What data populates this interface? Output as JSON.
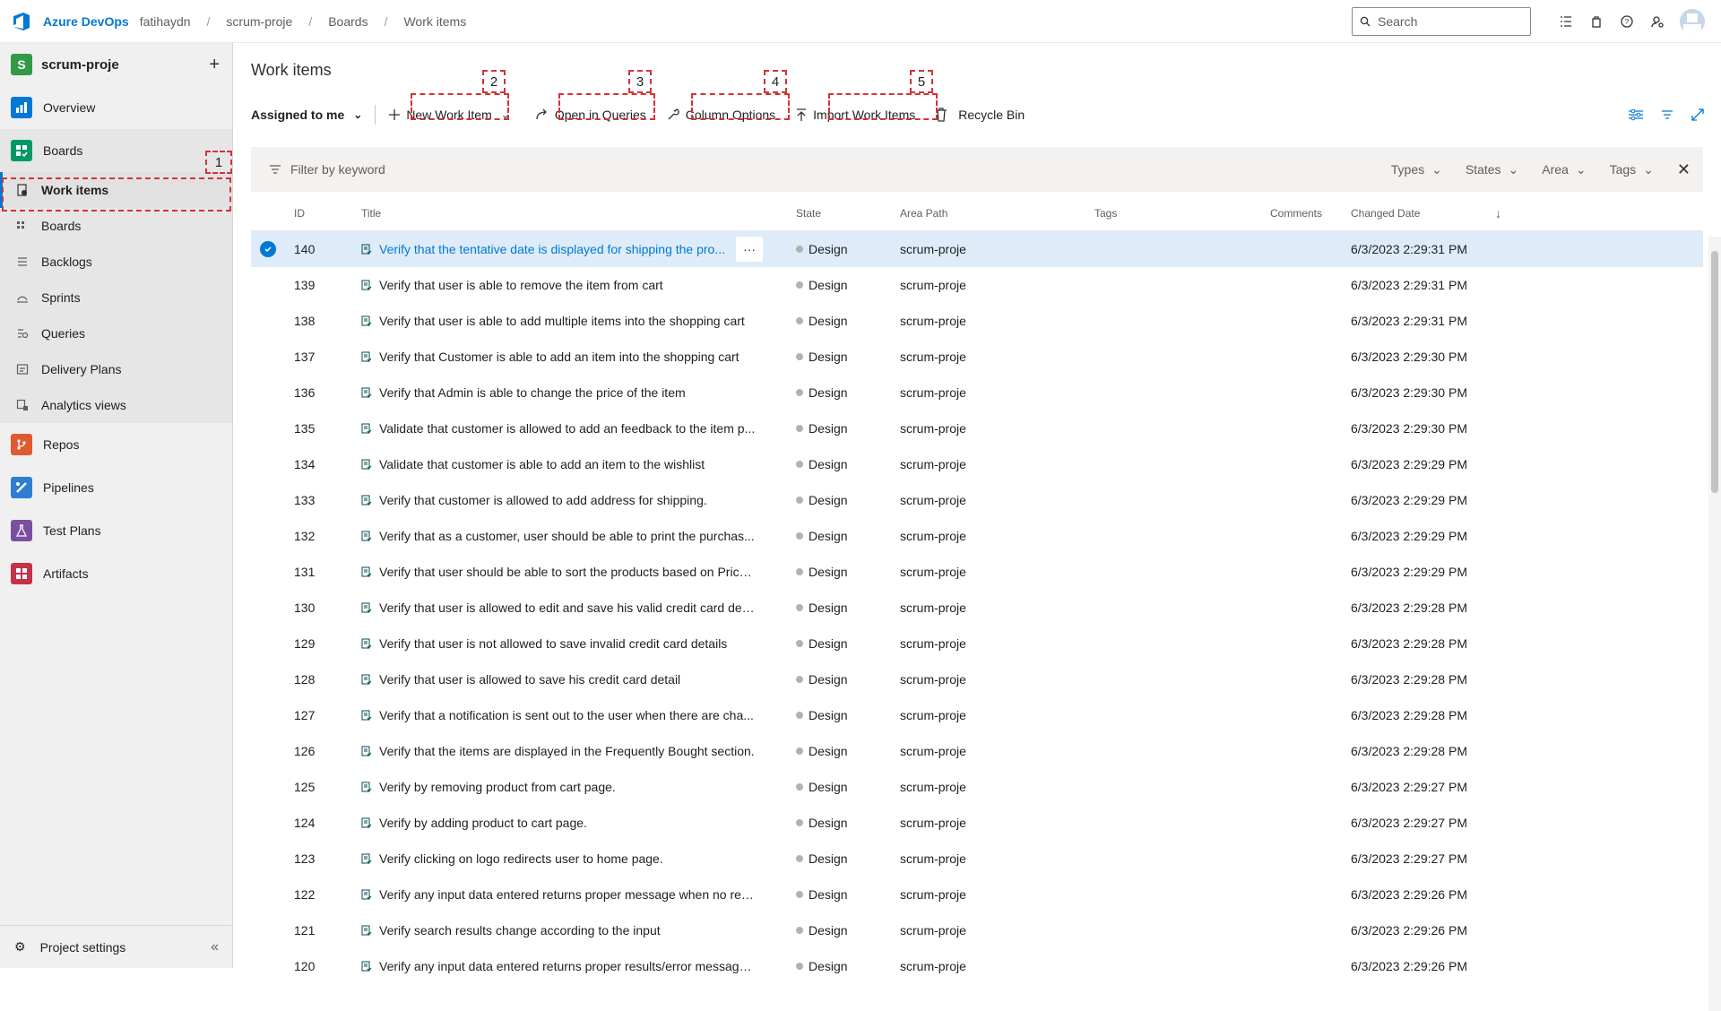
{
  "topbar": {
    "brand": "Azure DevOps",
    "breadcrumbs": [
      "fatihaydn",
      "scrum-proje",
      "Boards",
      "Work items"
    ],
    "search_placeholder": "Search"
  },
  "sidebar": {
    "project_initial": "S",
    "project_name": "scrum-proje",
    "items": [
      {
        "label": "Overview",
        "icon": "overview-icon",
        "color": "#0078d4"
      },
      {
        "label": "Boards",
        "icon": "boards-icon",
        "color": "#009966"
      },
      {
        "label": "Repos",
        "icon": "repos-icon",
        "color": "#e05b2f"
      },
      {
        "label": "Pipelines",
        "icon": "pipelines-icon",
        "color": "#2d7dd2"
      },
      {
        "label": "Test Plans",
        "icon": "test-plans-icon",
        "color": "#7a4fa0"
      },
      {
        "label": "Artifacts",
        "icon": "artifacts-icon",
        "color": "#c4314b"
      }
    ],
    "boards_sub": [
      {
        "label": "Work items",
        "icon": "work-items-icon"
      },
      {
        "label": "Boards",
        "icon": "boards-sub-icon"
      },
      {
        "label": "Backlogs",
        "icon": "backlogs-icon"
      },
      {
        "label": "Sprints",
        "icon": "sprints-icon"
      },
      {
        "label": "Queries",
        "icon": "queries-icon"
      },
      {
        "label": "Delivery Plans",
        "icon": "delivery-plans-icon"
      },
      {
        "label": "Analytics views",
        "icon": "analytics-views-icon"
      }
    ],
    "project_settings": "Project settings"
  },
  "annotations": [
    "1",
    "2",
    "3",
    "4",
    "5"
  ],
  "main": {
    "title": "Work items",
    "toolbar": {
      "assigned": "Assigned to me",
      "new_work_item": "New Work Item",
      "open_in_queries": "Open in Queries",
      "column_options": "Column Options",
      "import_work_items": "Import Work Items",
      "recycle_bin": "Recycle Bin"
    },
    "filter": {
      "placeholder": "Filter by keyword",
      "dropdowns": [
        "Types",
        "States",
        "Area",
        "Tags"
      ]
    },
    "columns": {
      "id": "ID",
      "title": "Title",
      "state": "State",
      "area": "Area Path",
      "tags": "Tags",
      "comments": "Comments",
      "changed": "Changed Date"
    },
    "rows": [
      {
        "id": "140",
        "title": "Verify that the tentative date is displayed for shipping the pro...",
        "state": "Design",
        "area": "scrum-proje",
        "date": "6/3/2023 2:29:31 PM"
      },
      {
        "id": "139",
        "title": "Verify that user is able to remove the item from cart",
        "state": "Design",
        "area": "scrum-proje",
        "date": "6/3/2023 2:29:31 PM"
      },
      {
        "id": "138",
        "title": "Verify that user is able to add multiple items into the shopping cart",
        "state": "Design",
        "area": "scrum-proje",
        "date": "6/3/2023 2:29:31 PM"
      },
      {
        "id": "137",
        "title": "Verify that Customer is able to add an item into the shopping cart",
        "state": "Design",
        "area": "scrum-proje",
        "date": "6/3/2023 2:29:30 PM"
      },
      {
        "id": "136",
        "title": "Verify that Admin is able to change the price of the item",
        "state": "Design",
        "area": "scrum-proje",
        "date": "6/3/2023 2:29:30 PM"
      },
      {
        "id": "135",
        "title": "Validate that customer is allowed to add an feedback to the item p...",
        "state": "Design",
        "area": "scrum-proje",
        "date": "6/3/2023 2:29:30 PM"
      },
      {
        "id": "134",
        "title": "Validate that customer is able to add an item to the wishlist",
        "state": "Design",
        "area": "scrum-proje",
        "date": "6/3/2023 2:29:29 PM"
      },
      {
        "id": "133",
        "title": "Verify that customer is allowed to add address for shipping.",
        "state": "Design",
        "area": "scrum-proje",
        "date": "6/3/2023 2:29:29 PM"
      },
      {
        "id": "132",
        "title": "Verify that as a customer, user should be able to print the purchas...",
        "state": "Design",
        "area": "scrum-proje",
        "date": "6/3/2023 2:29:29 PM"
      },
      {
        "id": "131",
        "title": "Verify that user should be able to sort the products based on Price ...",
        "state": "Design",
        "area": "scrum-proje",
        "date": "6/3/2023 2:29:29 PM"
      },
      {
        "id": "130",
        "title": "Verify that user is allowed to edit and save his valid credit card det...",
        "state": "Design",
        "area": "scrum-proje",
        "date": "6/3/2023 2:29:28 PM"
      },
      {
        "id": "129",
        "title": "Verify that user is not allowed to save invalid credit card details",
        "state": "Design",
        "area": "scrum-proje",
        "date": "6/3/2023 2:29:28 PM"
      },
      {
        "id": "128",
        "title": "Verify that user is allowed to save his credit card detail",
        "state": "Design",
        "area": "scrum-proje",
        "date": "6/3/2023 2:29:28 PM"
      },
      {
        "id": "127",
        "title": "Verify that a notification is sent out to the user when there are cha...",
        "state": "Design",
        "area": "scrum-proje",
        "date": "6/3/2023 2:29:28 PM"
      },
      {
        "id": "126",
        "title": "Verify that the items are displayed in the Frequently Bought section.",
        "state": "Design",
        "area": "scrum-proje",
        "date": "6/3/2023 2:29:28 PM"
      },
      {
        "id": "125",
        "title": "Verify by removing product from cart page.",
        "state": "Design",
        "area": "scrum-proje",
        "date": "6/3/2023 2:29:27 PM"
      },
      {
        "id": "124",
        "title": "Verify by adding product to cart page.",
        "state": "Design",
        "area": "scrum-proje",
        "date": "6/3/2023 2:29:27 PM"
      },
      {
        "id": "123",
        "title": "Verify clicking on logo redirects user to home page.",
        "state": "Design",
        "area": "scrum-proje",
        "date": "6/3/2023 2:29:27 PM"
      },
      {
        "id": "122",
        "title": "Verify any input data entered returns proper message when no res...",
        "state": "Design",
        "area": "scrum-proje",
        "date": "6/3/2023 2:29:26 PM"
      },
      {
        "id": "121",
        "title": "Verify search results change according to the input",
        "state": "Design",
        "area": "scrum-proje",
        "date": "6/3/2023 2:29:26 PM"
      },
      {
        "id": "120",
        "title": "Verify any input data entered returns proper results/error message...",
        "state": "Design",
        "area": "scrum-proje",
        "date": "6/3/2023 2:29:26 PM"
      }
    ]
  },
  "colors": {
    "accent": "#0078d4",
    "annotation": "#d13438",
    "selected_row": "#deecf9"
  }
}
